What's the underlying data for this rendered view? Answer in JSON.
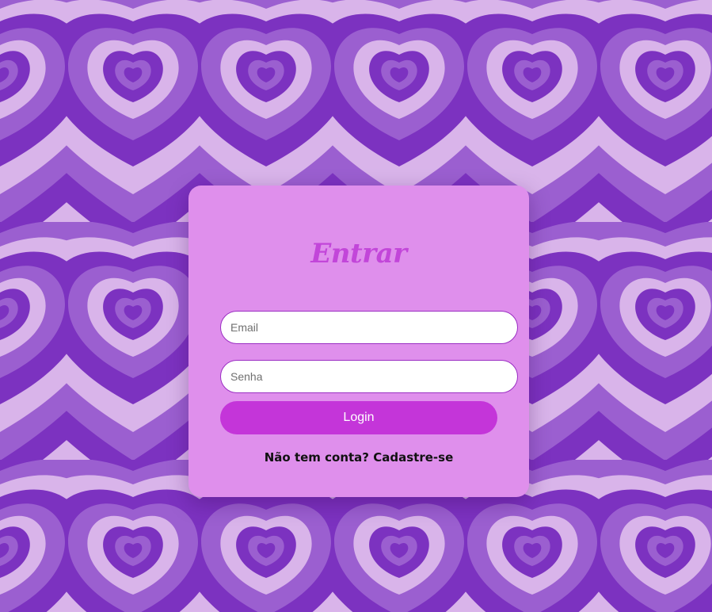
{
  "background": {
    "pattern": "concentric-hearts",
    "colors": [
      "#7c32c0",
      "#9b5fd0",
      "#d9b4ea"
    ]
  },
  "login_card": {
    "title": "Entrar",
    "email_placeholder": "Email",
    "password_placeholder": "Senha",
    "login_button": "Login",
    "signup_prompt": "Não tem conta?",
    "signup_link": "Cadastre-se",
    "card_color": "#df8fec",
    "accent_color": "#c435d9"
  }
}
